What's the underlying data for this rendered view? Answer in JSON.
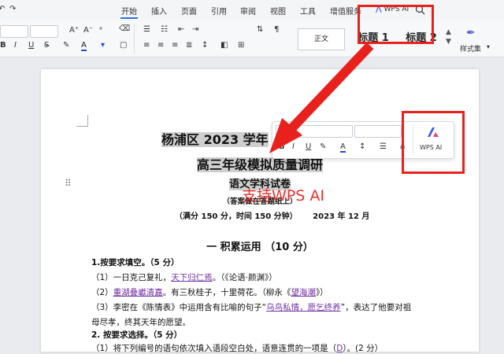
{
  "tabs": [
    "开始",
    "插入",
    "页面",
    "引用",
    "审阅",
    "视图",
    "工具",
    "增值服务"
  ],
  "active_tab": "开始",
  "wps_ai_tab": "WPS AI",
  "toolbar": {
    "font_size_up": "A⁺",
    "font_size_down": "A⁻",
    "bold": "B",
    "italic": "I",
    "underline": "U",
    "font_color": "A",
    "style_normal": "正文",
    "style_heading1": "标题 1",
    "style_heading2": "标题 2",
    "style_set": "样式集"
  },
  "minitoolbar": {
    "bold": "B",
    "italic": "I",
    "underline": "U",
    "font_color": "A",
    "wps_ai": "WPS AI"
  },
  "annotation": "支持WPS AI",
  "doc": {
    "title1": "杨浦区 2023 学年",
    "title2": "高三年级模拟质量调研",
    "title3": "语文学科试卷",
    "note": "（答案做在答题纸上）",
    "meta1": "（满分 150 分，时间 150 分钟）",
    "meta2": "2023 年 12 月",
    "section": "一  积累运用  （10 分）",
    "q1": "1.按要求填空。（5 分）",
    "q1_1a": "（1）一日克己复礼，",
    "q1_1b": "天下归仁焉",
    "q1_1c": "。（《论语·颜渊》）",
    "q1_2a": "（2）",
    "q1_2b": "重湖叠巘清嘉",
    "q1_2c": "。有三秋桂子，十里荷花。（柳永《",
    "q1_2d": "望海潮",
    "q1_2e": "》）",
    "q1_3a": "（3）李密在《陈情表》中运用含有比喻的句子“",
    "q1_3b": "乌鸟私情，愿乞终养",
    "q1_3c": "”，表达了他要对祖",
    "q1_3d": "母尽孝，终其天年的愿望。",
    "q2": "2. 按要求选择。（5 分）",
    "q2_1a": "（1）将下列编号的语句依次填入语段空白处，语意连贯的一项是（",
    "q2_1b": "D",
    "q2_1c": "）。(2 分）"
  },
  "colors": {
    "accent": "#2f6fe0",
    "red": "#e8211d",
    "purple": "#7030a0"
  }
}
